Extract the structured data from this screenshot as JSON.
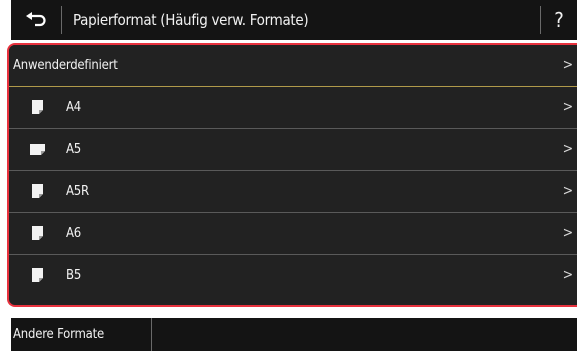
{
  "header": {
    "back_icon": "return-arrow-icon",
    "title": "Papierformat (Häufig verw. Formate)",
    "help_label": "?"
  },
  "list": {
    "items": [
      {
        "label": "Anwenderdefiniert",
        "icon": null
      },
      {
        "label": "A4",
        "icon": "paper-portrait-icon"
      },
      {
        "label": "A5",
        "icon": "paper-landscape-icon"
      },
      {
        "label": "A5R",
        "icon": "paper-portrait-icon"
      },
      {
        "label": "A6",
        "icon": "paper-portrait-icon"
      },
      {
        "label": "B5",
        "icon": "paper-portrait-icon"
      }
    ],
    "chevron": ">"
  },
  "footer": {
    "other_formats_label": "Andere Formate"
  },
  "colors": {
    "header_bg": "#141414",
    "list_bg": "#222222",
    "selection_border": "#e8323e",
    "highlight_divider": "#b09a4a"
  }
}
